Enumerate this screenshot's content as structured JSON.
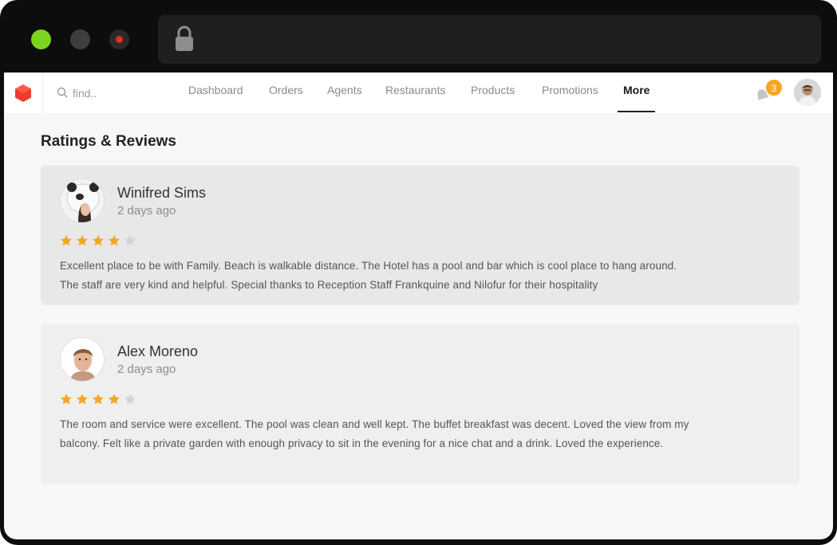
{
  "nav": {
    "search_placeholder": "find..",
    "items": [
      {
        "label": "Dashboard"
      },
      {
        "label": "Orders"
      },
      {
        "label": "Agents"
      },
      {
        "label": "Restaurants"
      },
      {
        "label": "Products"
      },
      {
        "label": "Promotions"
      },
      {
        "label": "More"
      }
    ],
    "active_item": "More",
    "notification_count": "3"
  },
  "page": {
    "title": "Ratings & Reviews"
  },
  "reviews": [
    {
      "name": "Winifred Sims",
      "date": "2 days ago",
      "rating": 4,
      "max_rating": 5,
      "text": "Excellent place to be with Family. Beach is walkable distance. The Hotel has a pool and bar which is cool place to hang around. The staff are very kind and helpful. Special thanks to Reception Staff Frankquine and Nilofur for their hospitality"
    },
    {
      "name": "Alex Moreno",
      "date": "2 days ago",
      "rating": 4,
      "max_rating": 5,
      "text": "The room and service were excellent. The pool was clean and well kept. The buffet breakfast was decent. Loved the view from my balcony. Felt like a private garden with enough privacy to sit in the evening for a nice chat and a drink. Loved the experience."
    }
  ],
  "colors": {
    "brand": "#f03a2e",
    "star_filled": "#f5a623",
    "star_empty": "#d4d4d4",
    "badge": "#f5a623"
  }
}
